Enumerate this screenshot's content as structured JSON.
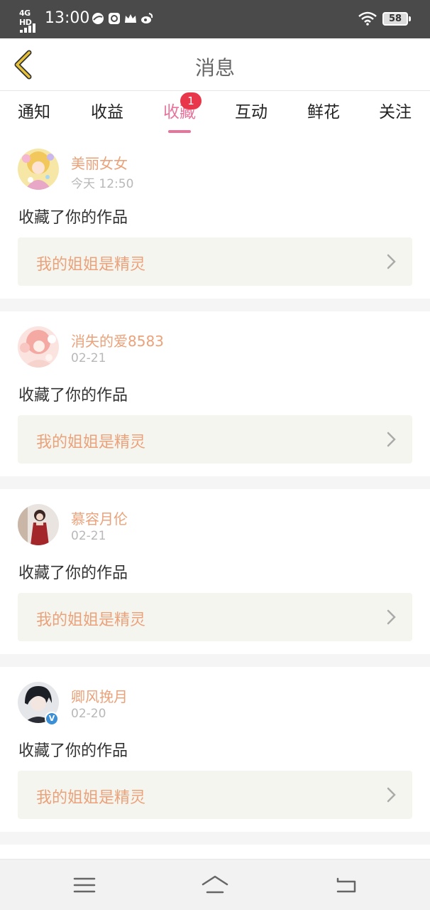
{
  "status_bar": {
    "network": "4G HD",
    "time": "13:00",
    "icons": [
      "app-icon",
      "message-icon",
      "crown-icon",
      "weibo-icon"
    ],
    "battery": "58"
  },
  "header": {
    "back_icon": "chevron-left-icon",
    "title": "消息"
  },
  "tabs": [
    {
      "label": "通知",
      "active": false
    },
    {
      "label": "收益",
      "active": false
    },
    {
      "label": "收藏",
      "active": true,
      "badge": "1"
    },
    {
      "label": "互动",
      "active": false
    },
    {
      "label": "鲜花",
      "active": false
    },
    {
      "label": "关注",
      "active": false
    }
  ],
  "notifications": [
    {
      "user": "美丽女女",
      "time": "今天 12:50",
      "action": "收藏了你的作品",
      "work_title": "我的姐姐是精灵",
      "verified": false
    },
    {
      "user": "消失的爱8583",
      "time": "02-21",
      "action": "收藏了你的作品",
      "work_title": "我的姐姐是精灵",
      "verified": false
    },
    {
      "user": "慕容月伦",
      "time": "02-21",
      "action": "收藏了你的作品",
      "work_title": "我的姐姐是精灵",
      "verified": false
    },
    {
      "user": "卿风挽月",
      "time": "02-20",
      "action": "收藏了你的作品",
      "work_title": "我的姐姐是精灵",
      "verified": true,
      "verified_mark": "V"
    }
  ],
  "nav_bar": {
    "icons": [
      "menu-icon",
      "home-icon",
      "back-icon"
    ]
  },
  "colors": {
    "accent": "#e8739b",
    "badge": "#e8364a",
    "username": "#eba27a",
    "back_arrow": "#e8c23a"
  }
}
